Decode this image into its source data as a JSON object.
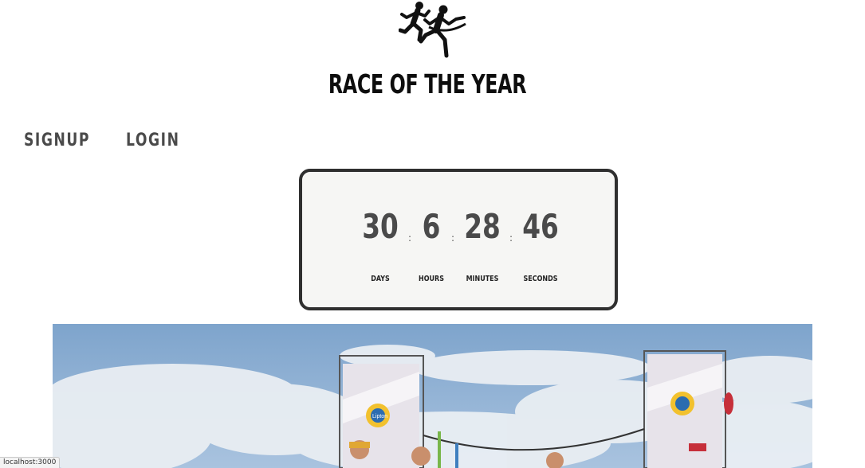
{
  "header": {
    "logo_icon": "runners-racing-icon",
    "title": "RACE OF THE YEAR"
  },
  "nav": {
    "signup_label": "SIGNUP",
    "login_label": "LOGIN"
  },
  "countdown": {
    "days": {
      "value": "30",
      "label": "DAYS"
    },
    "hours": {
      "value": "6",
      "label": "HOURS"
    },
    "minutes": {
      "value": "28",
      "label": "MINUTES"
    },
    "seconds": {
      "value": "46",
      "label": "SECONDS"
    },
    "separator": ":"
  },
  "hero": {
    "banner_text": "Lipton"
  },
  "status_bar": {
    "url": "localhost:3000"
  },
  "colors": {
    "title": "#0d0d0d",
    "nav": "#4a4a4a",
    "countdown_border": "#2f2f2f",
    "countdown_bg": "#f6f6f4",
    "countdown_digits": "#4a4a4a",
    "sky": "#7fa6cf"
  }
}
